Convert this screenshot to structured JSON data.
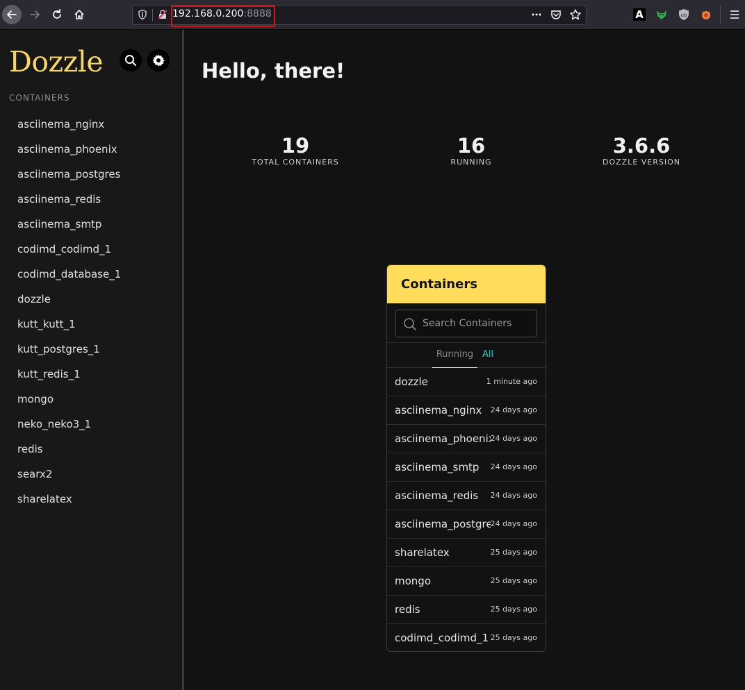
{
  "browser": {
    "url_host": "192.168.0.200",
    "url_port": ":8888",
    "ext_a_label": "A",
    "ext_ub_label": "ub"
  },
  "sidebar": {
    "logo": "Dozzle",
    "section_label": "CONTAINERS",
    "items": [
      "asciinema_nginx",
      "asciinema_phoenix",
      "asciinema_postgres",
      "asciinema_redis",
      "asciinema_smtp",
      "codimd_codimd_1",
      "codimd_database_1",
      "dozzle",
      "kutt_kutt_1",
      "kutt_postgres_1",
      "kutt_redis_1",
      "mongo",
      "neko_neko3_1",
      "redis",
      "searx2",
      "sharelatex"
    ]
  },
  "main": {
    "greeting": "Hello, there!",
    "stats": [
      {
        "value": "19",
        "label": "TOTAL CONTAINERS"
      },
      {
        "value": "16",
        "label": "RUNNING"
      },
      {
        "value": "3.6.6",
        "label": "DOZZLE VERSION"
      }
    ]
  },
  "panel": {
    "title": "Containers",
    "search_placeholder": "Search Containers",
    "tab_running": "Running",
    "tab_all": "All",
    "rows": [
      {
        "name": "dozzle",
        "time": "1 minute ago"
      },
      {
        "name": "asciinema_nginx",
        "time": "24 days ago"
      },
      {
        "name": "asciinema_phoenix",
        "time": "24 days ago"
      },
      {
        "name": "asciinema_smtp",
        "time": "24 days ago"
      },
      {
        "name": "asciinema_redis",
        "time": "24 days ago"
      },
      {
        "name": "asciinema_postgres",
        "time": "24 days ago"
      },
      {
        "name": "sharelatex",
        "time": "25 days ago"
      },
      {
        "name": "mongo",
        "time": "25 days ago"
      },
      {
        "name": "redis",
        "time": "25 days ago"
      },
      {
        "name": "codimd_codimd_1",
        "time": "25 days ago"
      }
    ]
  },
  "colors": {
    "accent": "#ffdc5a",
    "logo": "#f8d65f",
    "tab_active": "#36c5c0"
  }
}
